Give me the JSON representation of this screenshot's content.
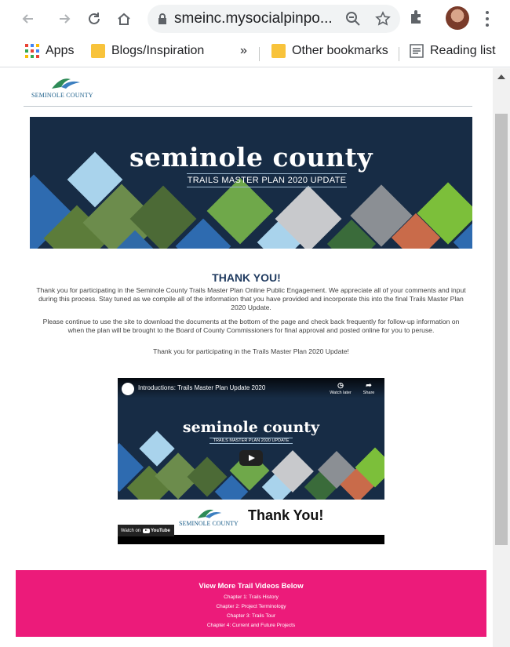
{
  "browser": {
    "url": "smeinc.mysocialpinpo...",
    "bookmarks": {
      "apps": "Apps",
      "blogs": "Blogs/Inspiration",
      "overflow": "»",
      "other": "Other bookmarks",
      "reading": "Reading list"
    }
  },
  "page": {
    "logo_text": "SEMINOLE COUNTY",
    "banner": {
      "title": "seminole county",
      "subtitle": "TRAILS MASTER PLAN 2020 UPDATE"
    },
    "thank_you": {
      "heading": "THANK YOU!",
      "para1": "Thank you for participating in the Seminole County Trails Master Plan Online Public Engagement. We appreciate all of your comments and input during this process. Stay tuned as we compile all of the information that you have provided and incorporate this into the final Trails Master Plan 2020 Update.",
      "para2": "Please continue to use the site to download the documents at the bottom of the page and check back frequently for follow-up information on when the plan will be brought to the Board of County Commissioners for final approval and posted online for you to peruse.",
      "para3": "Thank you for participating in the Trails Master Plan 2020 Update!"
    },
    "video": {
      "title": "Introductions: Trails Master Plan Update 2020",
      "watch_later": "Watch later",
      "share": "Share",
      "banner_title": "seminole county",
      "banner_subtitle": "TRAILS MASTER PLAN 2020 UPDATE",
      "logo_text": "SEMINOLE COUNTY",
      "thanks": "Thank You!",
      "watch_on": "Watch on",
      "youtube": "YouTube"
    },
    "trail_videos": {
      "heading": "View More Trail Videos Below",
      "links": [
        "Chapter 1: Trails History",
        "Chapter 2: Project Terminology",
        "Chapter 3: Trails Tour",
        "Chapter 4: Current and Future Projects"
      ]
    }
  },
  "colors": {
    "banner_bg": "#172c45",
    "pink": "#ec1b7a",
    "heading": "#1f3a5f"
  }
}
